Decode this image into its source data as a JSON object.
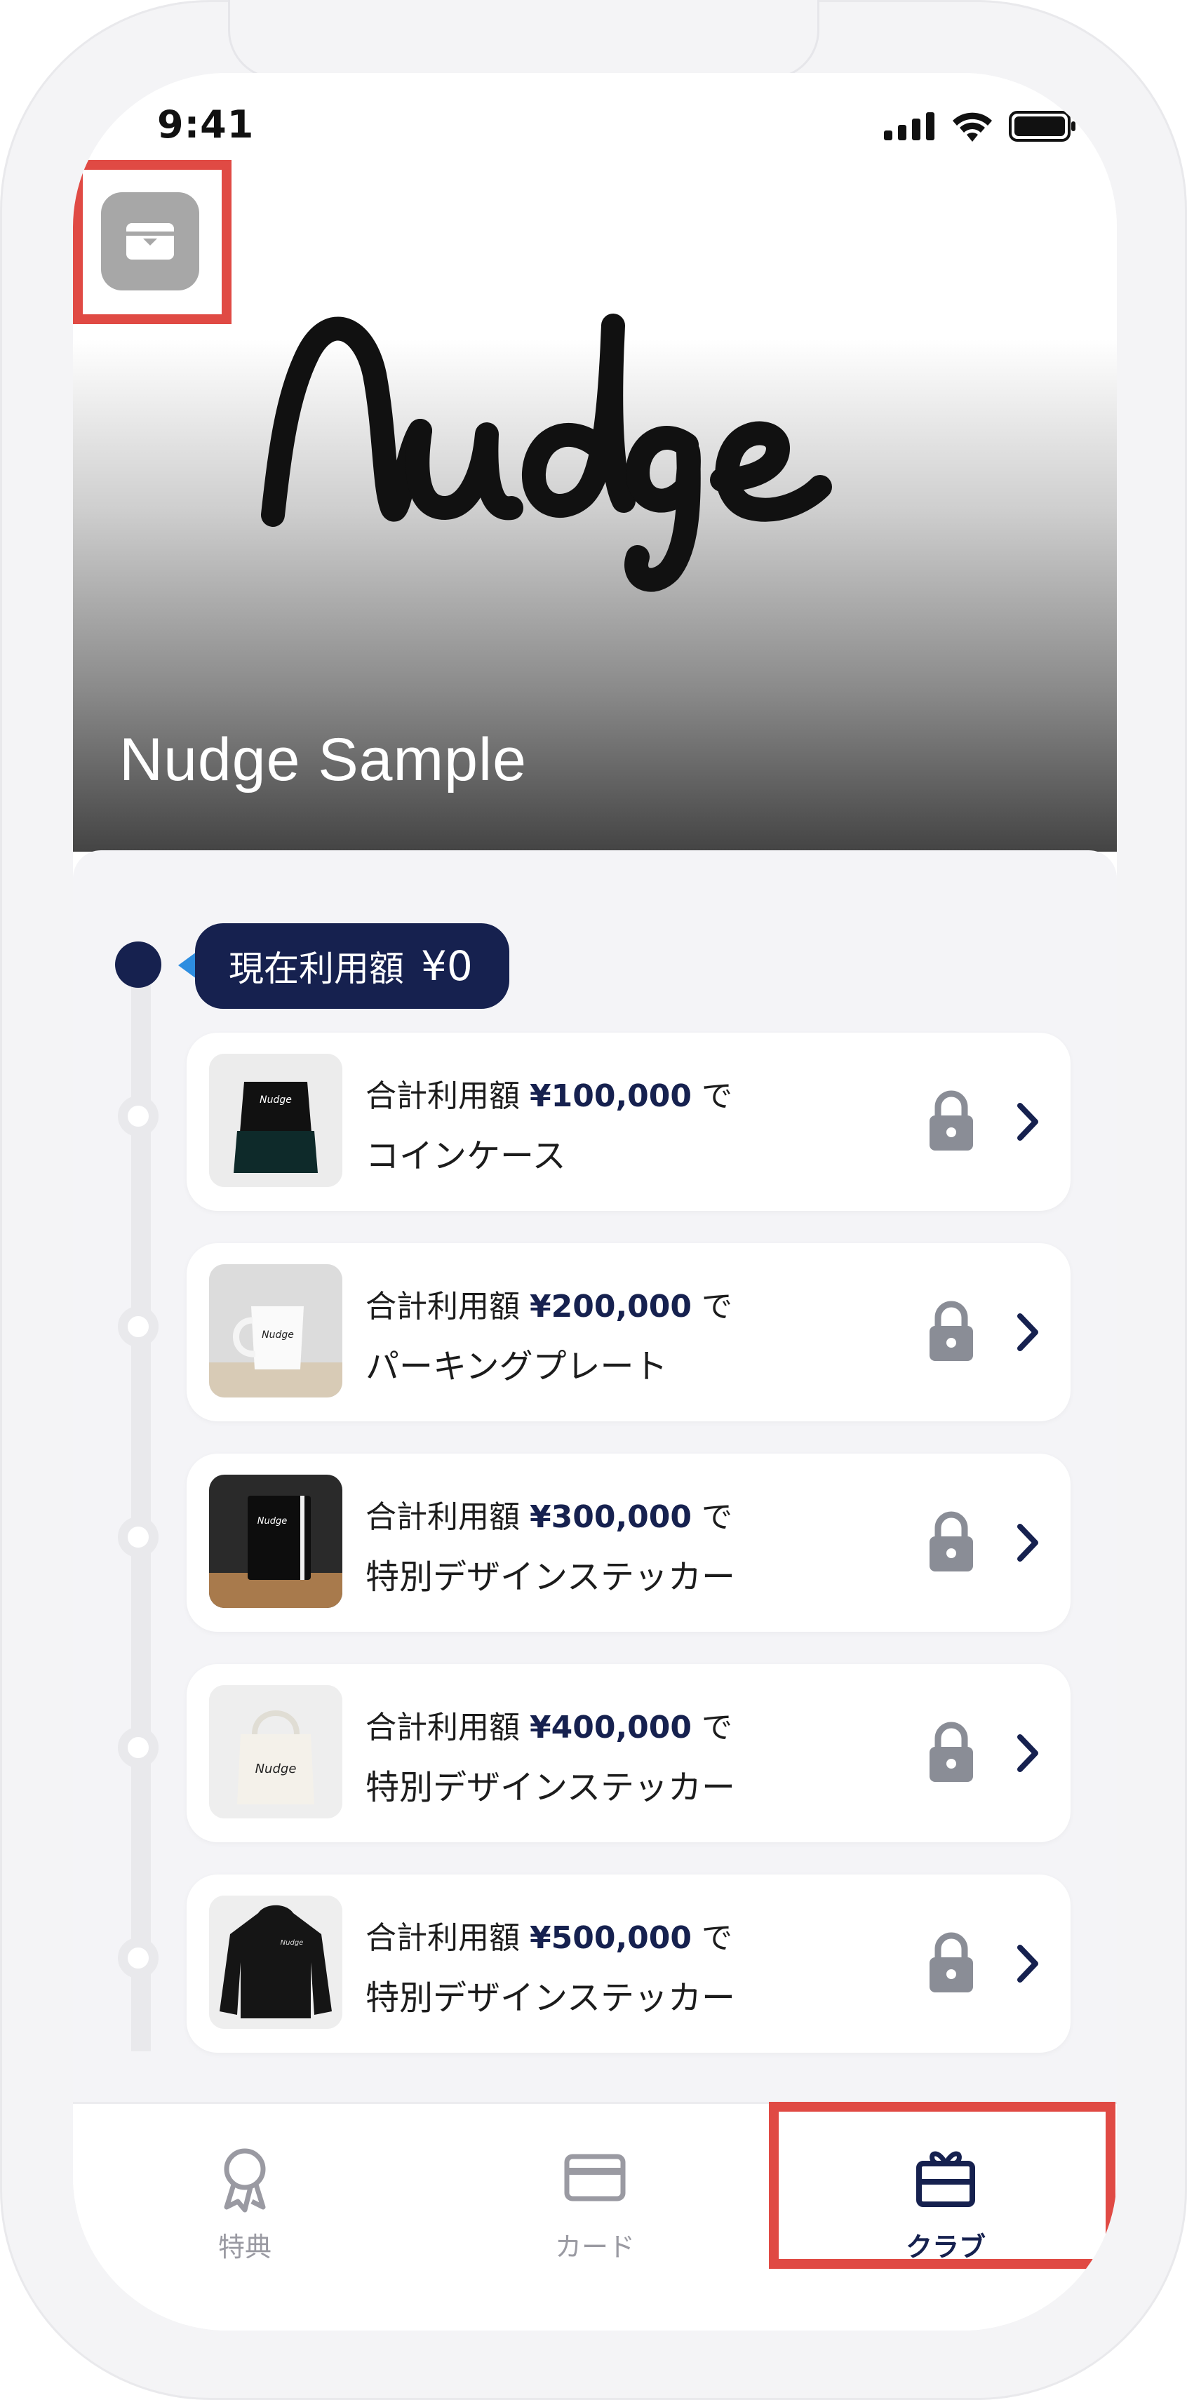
{
  "status_bar": {
    "time": "9:41"
  },
  "header": {
    "logo_text": "Nudge",
    "club_name": "Nudge Sample"
  },
  "progress": {
    "current_label": "現在利用額",
    "current_amount": "¥0"
  },
  "rewards": [
    {
      "condition_prefix": "合計利用額",
      "amount": "¥100,000",
      "condition_suffix": "で",
      "name": "コインケース",
      "locked": true,
      "thumb": "calendar"
    },
    {
      "condition_prefix": "合計利用額",
      "amount": "¥200,000",
      "condition_suffix": "で",
      "name": "パーキングプレート",
      "locked": true,
      "thumb": "mug"
    },
    {
      "condition_prefix": "合計利用額",
      "amount": "¥300,000",
      "condition_suffix": "で",
      "name": "特別デザインステッカー",
      "locked": true,
      "thumb": "notebook"
    },
    {
      "condition_prefix": "合計利用額",
      "amount": "¥400,000",
      "condition_suffix": "で",
      "name": "特別デザインステッカー",
      "locked": true,
      "thumb": "tote-bag"
    },
    {
      "condition_prefix": "合計利用額",
      "amount": "¥500,000",
      "condition_suffix": "で",
      "name": "特別デザインステッカー",
      "locked": true,
      "thumb": "hoodie"
    }
  ],
  "tabbar": {
    "tabs": [
      {
        "label": "特典",
        "icon": "award-icon",
        "active": false
      },
      {
        "label": "カード",
        "icon": "card-icon",
        "active": false
      },
      {
        "label": "クラブ",
        "icon": "gift-icon",
        "active": true
      }
    ]
  },
  "colors": {
    "accent": "#16214f",
    "highlight": "#e04a44",
    "inactive": "#9a9aa2"
  }
}
